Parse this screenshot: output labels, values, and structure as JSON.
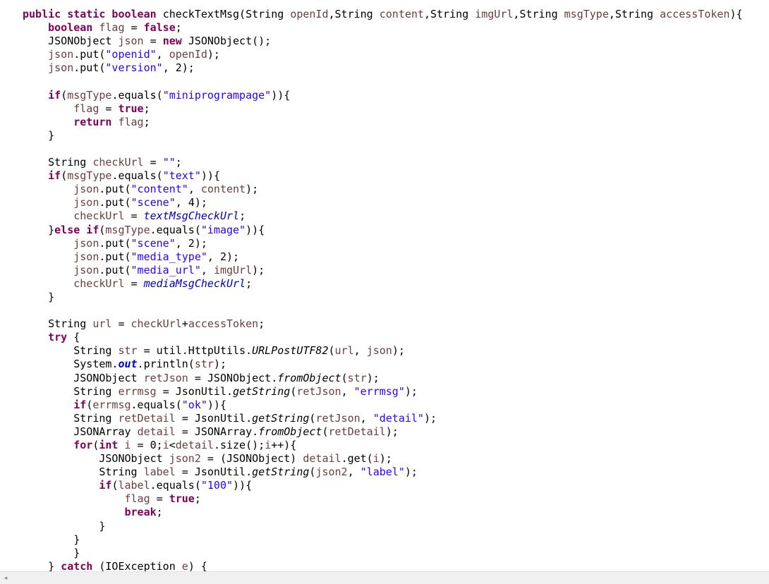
{
  "editor": {
    "lines": [
      [
        [
          "kw",
          "public static boolean "
        ],
        [
          "plain",
          "checkTextMsg(String "
        ],
        [
          "var",
          "openId"
        ],
        [
          "plain",
          ",String "
        ],
        [
          "var",
          "content"
        ],
        [
          "plain",
          ",String "
        ],
        [
          "var",
          "imgUrl"
        ],
        [
          "plain",
          ",String "
        ],
        [
          "var",
          "msgType"
        ],
        [
          "plain",
          ",String "
        ],
        [
          "var",
          "accessToken"
        ],
        [
          "plain",
          "){"
        ]
      ],
      [
        [
          "plain",
          "    "
        ],
        [
          "kw",
          "boolean "
        ],
        [
          "var",
          "flag"
        ],
        [
          "plain",
          " = "
        ],
        [
          "kw",
          "false"
        ],
        [
          "plain",
          ";"
        ]
      ],
      [
        [
          "plain",
          "    JSONObject "
        ],
        [
          "var",
          "json"
        ],
        [
          "plain",
          " = "
        ],
        [
          "kw",
          "new "
        ],
        [
          "plain",
          "JSONObject();"
        ]
      ],
      [
        [
          "plain",
          "    "
        ],
        [
          "var",
          "json"
        ],
        [
          "plain",
          ".put("
        ],
        [
          "str",
          "\"openid\""
        ],
        [
          "plain",
          ", "
        ],
        [
          "var",
          "openId"
        ],
        [
          "plain",
          ");"
        ]
      ],
      [
        [
          "plain",
          "    "
        ],
        [
          "var",
          "json"
        ],
        [
          "plain",
          ".put("
        ],
        [
          "str",
          "\"version\""
        ],
        [
          "plain",
          ", 2);"
        ]
      ],
      [
        [
          "plain",
          ""
        ]
      ],
      [
        [
          "plain",
          "    "
        ],
        [
          "kw",
          "if"
        ],
        [
          "plain",
          "("
        ],
        [
          "var",
          "msgType"
        ],
        [
          "plain",
          ".equals("
        ],
        [
          "str",
          "\"miniprogrampage\""
        ],
        [
          "plain",
          "))"
        ],
        [
          "plain",
          "{"
        ]
      ],
      [
        [
          "plain",
          "        "
        ],
        [
          "var",
          "flag"
        ],
        [
          "plain",
          " = "
        ],
        [
          "kw",
          "true"
        ],
        [
          "plain",
          ";"
        ]
      ],
      [
        [
          "plain",
          "        "
        ],
        [
          "kw",
          "return "
        ],
        [
          "var",
          "flag"
        ],
        [
          "plain",
          ";"
        ]
      ],
      [
        [
          "plain",
          "    }"
        ]
      ],
      [
        [
          "plain",
          ""
        ]
      ],
      [
        [
          "plain",
          "    String "
        ],
        [
          "var",
          "checkUrl"
        ],
        [
          "plain",
          " = "
        ],
        [
          "str",
          "\"\""
        ],
        [
          "plain",
          ";"
        ]
      ],
      [
        [
          "plain",
          "    "
        ],
        [
          "kw",
          "if"
        ],
        [
          "plain",
          "("
        ],
        [
          "var",
          "msgType"
        ],
        [
          "plain",
          ".equals("
        ],
        [
          "str",
          "\"text\""
        ],
        [
          "plain",
          "))"
        ],
        [
          "plain",
          "{"
        ]
      ],
      [
        [
          "plain",
          "        "
        ],
        [
          "var",
          "json"
        ],
        [
          "plain",
          ".put("
        ],
        [
          "str",
          "\"content\""
        ],
        [
          "plain",
          ", "
        ],
        [
          "var",
          "content"
        ],
        [
          "plain",
          ");"
        ]
      ],
      [
        [
          "plain",
          "        "
        ],
        [
          "var",
          "json"
        ],
        [
          "plain",
          ".put("
        ],
        [
          "str",
          "\"scene\""
        ],
        [
          "plain",
          ", 4);"
        ]
      ],
      [
        [
          "plain",
          "        "
        ],
        [
          "var",
          "checkUrl"
        ],
        [
          "plain",
          " = "
        ],
        [
          "fld",
          "textMsgCheckUrl"
        ],
        [
          "plain",
          ";"
        ]
      ],
      [
        [
          "plain",
          "    }"
        ],
        [
          "kw",
          "else if"
        ],
        [
          "plain",
          "("
        ],
        [
          "var",
          "msgType"
        ],
        [
          "plain",
          ".equals("
        ],
        [
          "str",
          "\"image\""
        ],
        [
          "plain",
          "))"
        ],
        [
          "plain",
          "{"
        ]
      ],
      [
        [
          "plain",
          "        "
        ],
        [
          "var",
          "json"
        ],
        [
          "plain",
          ".put("
        ],
        [
          "str",
          "\"scene\""
        ],
        [
          "plain",
          ", 2);"
        ]
      ],
      [
        [
          "plain",
          "        "
        ],
        [
          "var",
          "json"
        ],
        [
          "plain",
          ".put("
        ],
        [
          "str",
          "\"media_type\""
        ],
        [
          "plain",
          ", 2);"
        ]
      ],
      [
        [
          "plain",
          "        "
        ],
        [
          "var",
          "json"
        ],
        [
          "plain",
          ".put("
        ],
        [
          "str",
          "\"media_url\""
        ],
        [
          "plain",
          ", "
        ],
        [
          "var",
          "imgUrl"
        ],
        [
          "plain",
          ");"
        ]
      ],
      [
        [
          "plain",
          "        "
        ],
        [
          "var",
          "checkUrl"
        ],
        [
          "plain",
          " = "
        ],
        [
          "fld",
          "mediaMsgCheckUrl"
        ],
        [
          "plain",
          ";"
        ]
      ],
      [
        [
          "plain",
          "    }"
        ]
      ],
      [
        [
          "plain",
          ""
        ]
      ],
      [
        [
          "plain",
          "    String "
        ],
        [
          "var",
          "url"
        ],
        [
          "plain",
          " = "
        ],
        [
          "var",
          "checkUrl"
        ],
        [
          "plain",
          "+"
        ],
        [
          "var",
          "accessToken"
        ],
        [
          "plain",
          ";"
        ]
      ],
      [
        [
          "plain",
          "    "
        ],
        [
          "kw",
          "try"
        ],
        [
          "plain",
          " {"
        ]
      ],
      [
        [
          "plain",
          "        String "
        ],
        [
          "var",
          "str"
        ],
        [
          "plain",
          " = util.HttpUtils."
        ],
        [
          "it",
          "URLPostUTF82"
        ],
        [
          "plain",
          "("
        ],
        [
          "var",
          "url"
        ],
        [
          "plain",
          ", "
        ],
        [
          "var",
          "json"
        ],
        [
          "plain",
          ");"
        ]
      ],
      [
        [
          "plain",
          "        System."
        ],
        [
          "bfld",
          "out"
        ],
        [
          "plain",
          ".println("
        ],
        [
          "var",
          "str"
        ],
        [
          "plain",
          ");"
        ]
      ],
      [
        [
          "plain",
          "        JSONObject "
        ],
        [
          "var",
          "retJson"
        ],
        [
          "plain",
          " = JSONObject."
        ],
        [
          "it",
          "fromObject"
        ],
        [
          "plain",
          "("
        ],
        [
          "var",
          "str"
        ],
        [
          "plain",
          ");"
        ]
      ],
      [
        [
          "plain",
          "        String "
        ],
        [
          "var",
          "errmsg"
        ],
        [
          "plain",
          " = JsonUtil."
        ],
        [
          "it",
          "getString"
        ],
        [
          "plain",
          "("
        ],
        [
          "var",
          "retJson"
        ],
        [
          "plain",
          ", "
        ],
        [
          "str",
          "\"errmsg\""
        ],
        [
          "plain",
          ");"
        ]
      ],
      [
        [
          "plain",
          "        "
        ],
        [
          "kw",
          "if"
        ],
        [
          "plain",
          "("
        ],
        [
          "var",
          "errmsg"
        ],
        [
          "plain",
          ".equals("
        ],
        [
          "str",
          "\"ok\""
        ],
        [
          "plain",
          "))"
        ],
        [
          "plain",
          "{"
        ]
      ],
      [
        [
          "plain",
          "        String "
        ],
        [
          "var",
          "retDetail"
        ],
        [
          "plain",
          " = JsonUtil."
        ],
        [
          "it",
          "getString"
        ],
        [
          "plain",
          "("
        ],
        [
          "var",
          "retJson"
        ],
        [
          "plain",
          ", "
        ],
        [
          "str",
          "\"detail\""
        ],
        [
          "plain",
          ");"
        ]
      ],
      [
        [
          "plain",
          "        JSONArray "
        ],
        [
          "var",
          "detail"
        ],
        [
          "plain",
          " = JSONArray."
        ],
        [
          "it",
          "fromObject"
        ],
        [
          "plain",
          "("
        ],
        [
          "var",
          "retDetail"
        ],
        [
          "plain",
          ");"
        ]
      ],
      [
        [
          "plain",
          "        "
        ],
        [
          "kw",
          "for"
        ],
        [
          "plain",
          "("
        ],
        [
          "kw",
          "int "
        ],
        [
          "var",
          "i"
        ],
        [
          "plain",
          " = 0;"
        ],
        [
          "var",
          "i"
        ],
        [
          "plain",
          "<"
        ],
        [
          "var",
          "detail"
        ],
        [
          "plain",
          ".size();"
        ],
        [
          "var",
          "i"
        ],
        [
          "plain",
          "++){"
        ]
      ],
      [
        [
          "plain",
          "            JSONObject "
        ],
        [
          "var",
          "json2"
        ],
        [
          "plain",
          " = (JSONObject) "
        ],
        [
          "var",
          "detail"
        ],
        [
          "plain",
          ".get("
        ],
        [
          "var",
          "i"
        ],
        [
          "plain",
          ");"
        ]
      ],
      [
        [
          "plain",
          "            String "
        ],
        [
          "var",
          "label"
        ],
        [
          "plain",
          " = JsonUtil."
        ],
        [
          "it",
          "getString"
        ],
        [
          "plain",
          "("
        ],
        [
          "var",
          "json2"
        ],
        [
          "plain",
          ", "
        ],
        [
          "str",
          "\"label\""
        ],
        [
          "plain",
          ");"
        ]
      ],
      [
        [
          "plain",
          "            "
        ],
        [
          "kw",
          "if"
        ],
        [
          "plain",
          "("
        ],
        [
          "var",
          "label"
        ],
        [
          "plain",
          ".equals("
        ],
        [
          "str",
          "\"100\""
        ],
        [
          "plain",
          "))"
        ],
        [
          "plain",
          "{"
        ]
      ],
      [
        [
          "plain",
          "                "
        ],
        [
          "var",
          "flag"
        ],
        [
          "plain",
          " = "
        ],
        [
          "kw",
          "true"
        ],
        [
          "plain",
          ";"
        ]
      ],
      [
        [
          "plain",
          "                "
        ],
        [
          "kw",
          "break"
        ],
        [
          "plain",
          ";"
        ]
      ],
      [
        [
          "plain",
          "            }"
        ]
      ],
      [
        [
          "plain",
          "        }"
        ]
      ],
      [
        [
          "plain",
          "        }"
        ]
      ],
      [
        [
          "plain",
          "    } "
        ],
        [
          "kw",
          "catch"
        ],
        [
          "plain",
          " (IOException "
        ],
        [
          "var",
          "e"
        ],
        [
          "plain",
          ") {"
        ]
      ]
    ]
  },
  "scrollbar": {
    "left_arrow": "◂"
  }
}
